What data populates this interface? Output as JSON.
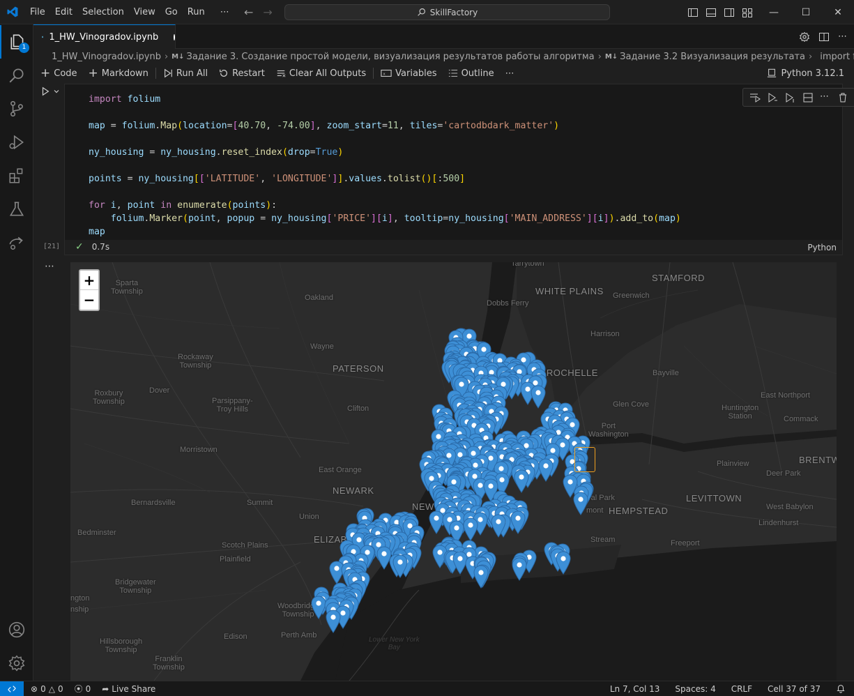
{
  "menu": [
    "File",
    "Edit",
    "Selection",
    "View",
    "Go",
    "Run",
    "⋯"
  ],
  "search": {
    "label": "SkillFactory"
  },
  "activity": {
    "badge": "1"
  },
  "tab": {
    "title": "1_HW_Vinogradov.ipynb"
  },
  "breadcrumb": {
    "file": "1_HW_Vinogradov.ipynb",
    "md1": "M↓",
    "section1": "Задание 3. Создание простой модели, визуализация результатов работы алгоритма",
    "md2": "M↓",
    "section2": "Задание 3.2 Визуализация результата",
    "symbol": "import folium"
  },
  "toolbar": {
    "code": "Code",
    "markdown": "Markdown",
    "run_all": "Run All",
    "restart": "Restart",
    "clear_outputs": "Clear All Outputs",
    "variables": "Variables",
    "outline": "Outline",
    "more": "⋯",
    "kernel": "Python 3.12.1"
  },
  "cell": {
    "exec_count": "[21]",
    "duration": "0.7s",
    "language": "Python",
    "output_menu": "⋯"
  },
  "code": {
    "l1_kw": "import",
    "l1_mod": "folium",
    "l3_var": "map",
    "l3_mod": "folium",
    "l3_fn": "Map",
    "l3_arg1": "location",
    "l3_n1": "40.70",
    "l3_n2": "-74.00",
    "l3_arg2": "zoom_start",
    "l3_n3": "11",
    "l3_arg3": "tiles",
    "l3_s1": "'cartodbdark_matter'",
    "l5_var": "ny_housing",
    "l5_var2": "ny_housing",
    "l5_fn": "reset_index",
    "l5_arg": "drop",
    "l5_bool": "True",
    "l7_var": "points",
    "l7_var2": "ny_housing",
    "l7_s1": "'LATITUDE'",
    "l7_s2": "'LONGITUDE'",
    "l7_p1": "values",
    "l7_fn": "tolist",
    "l7_n": "500",
    "l9_kw1": "for",
    "l9_v1": "i",
    "l9_v2": "point",
    "l9_kw2": "in",
    "l9_fn": "enumerate",
    "l9_v3": "points",
    "l10_mod": "folium",
    "l10_fn": "Marker",
    "l10_v1": "point",
    "l10_arg1": "popup",
    "l10_v2": "ny_housing",
    "l10_s1": "'PRICE'",
    "l10_v3": "i",
    "l10_arg2": "tooltip",
    "l10_v4": "ny_housing",
    "l10_s2": "'MAIN_ADDRESS'",
    "l10_v5": "i",
    "l10_fn2": "add_to",
    "l10_v6": "map",
    "l11_var": "map"
  },
  "map": {
    "zoom_in": "+",
    "zoom_out": "−",
    "marker_color": "#3d8fd6",
    "labels": {
      "tarrytown": "Tarrytown",
      "white_plains": "WHITE PLAINS",
      "stamford": "STAMFORD",
      "sparta": "Sparta\nTownship",
      "oakland": "Oakland",
      "greenwich": "Greenwich",
      "dobbs_ferry": "Dobbs Ferry",
      "harrison": "Harrison",
      "wayne": "Wayne",
      "rockaway": "Rockaway\nTownship",
      "paterson": "PATERSON",
      "rochelle": "W ROCHELLE",
      "bayville": "Bayville",
      "dover": "Dover",
      "roxbury": "Roxbury\nTownship",
      "parsippany": "Parsippany-\nTroy Hills",
      "clifton": "Clifton",
      "glen_cove": "Glen Cove",
      "huntington": "Huntington\nStation",
      "east_northport": "East Northport",
      "commack": "Commack",
      "port_washington": "Port\nWashington",
      "morristown": "Morristown",
      "brentwood": "BRENTWO",
      "plainview": "Plainview",
      "east_orange": "East Orange",
      "deer_park": "Deer Park",
      "newark": "NEWARK",
      "new": "NEW",
      "bernardsville": "Bernardsville",
      "summit": "Summit",
      "levittown": "LEVITTOWN",
      "floral_park": "ral Park",
      "hempstead": "HEMPSTEAD",
      "mont": "mont",
      "west_babylon": "West Babylon",
      "union": "Union",
      "lindenhurst": "Lindenhurst",
      "bedminster": "Bedminster",
      "elizabeth": "ELIZABETH",
      "stream": "Stream",
      "freeport": "Freeport",
      "scotch_plains": "Scotch Plains",
      "plainfield": "Plainfield",
      "bridgewater": "Bridgewater\nTownship",
      "ngton": "ngton",
      "nship": "nship",
      "woodbridge": "Woodbridge\nTownship",
      "edison": "Edison",
      "perth_amboy": "Perth Amb",
      "lower_ny_bay": "Lower New York\nBay",
      "hillsborough": "Hillsborough\nTownship",
      "franklin": "Franklin\nTownship"
    }
  },
  "status": {
    "errors": "0",
    "warnings": "0",
    "ports": "0",
    "live_share": "Live Share",
    "position": "Ln 7, Col 13",
    "spaces": "Spaces: 4",
    "eol": "CRLF",
    "cell": "Cell 37 of 37"
  }
}
